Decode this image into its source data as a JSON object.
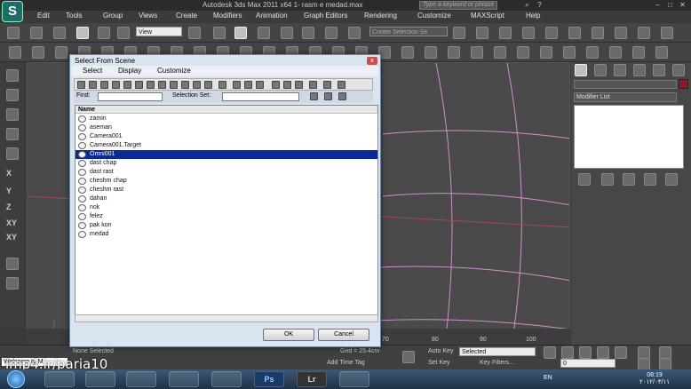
{
  "titlebar": {
    "title": "Autodesk 3ds Max  2011 x64     1- rasm e medad.max",
    "search_placeholder": "Type a keyword or phrase"
  },
  "menubar": [
    "Edit",
    "Tools",
    "Group",
    "Views",
    "Create",
    "Modifiers",
    "Animation",
    "Graph Editors",
    "Rendering",
    "Customize",
    "MAXScript",
    "Help"
  ],
  "toolbar": {
    "view_dropdown": "View",
    "named_selection": "Create Selection Se"
  },
  "lefttools": {
    "labels": [
      "X",
      "Y",
      "Z",
      "XY",
      "XY"
    ]
  },
  "cmdpanel": {
    "modifier_list": "Modifier List"
  },
  "dialog": {
    "title": "Select From Scene",
    "close": "x",
    "menus": [
      "Select",
      "Display",
      "Customize"
    ],
    "find_label": "Find:",
    "selection_set_label": "Selection Set:",
    "column_name": "Name",
    "items": [
      "zamin",
      "aseman",
      "Camera001",
      "Camera001.Target",
      "Omni001",
      "dast chap",
      "dast rast",
      "cheshm chap",
      "cheshm rast",
      "dahan",
      "nok",
      "felez",
      "pak kon",
      "medad"
    ],
    "selected_index": 4,
    "ok": "OK",
    "cancel": "Cancel"
  },
  "timeline": {
    "ticks": [
      "70",
      "80",
      "90",
      "100"
    ]
  },
  "statusbar": {
    "none_selected": "None Selected",
    "grid": "Grid = 25.4cm",
    "auto_key": "Auto Key",
    "set_key": "Set Key",
    "selected": "Selected",
    "key_filters": "Key Filters...",
    "add_time_tag": "Add Time Tag",
    "frame": "0",
    "welcome": "Welcome to M"
  },
  "watermark": "imp4.ir/paria10",
  "taskbar": {
    "lang": "EN",
    "time": "08:19",
    "date": "۲۰۱۲/۰۳/۱۱",
    "apps": [
      "Ps",
      "Lr"
    ]
  },
  "colors": {
    "selection": "#0a2a9a",
    "viewport_lines": "#d58fd0",
    "accent_red": "#8a1a2a"
  }
}
